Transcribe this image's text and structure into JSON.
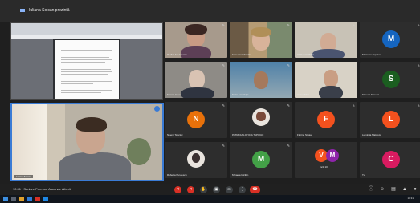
{
  "window": {
    "title": "Iuliana Soican prezintă"
  },
  "shared_screen": {
    "caption": ""
  },
  "presenter": {
    "name": "Iuliana Soican"
  },
  "participants": [
    {
      "name": "Rodica Medeleanu",
      "kind": "video"
    },
    {
      "name": "Florentina Zamfir",
      "kind": "video"
    },
    {
      "name": "Chirtoacă Mihai",
      "kind": "video"
    },
    {
      "name": "Marioara Tapciuc",
      "kind": "avatar",
      "initial": "M",
      "color": "#1565c0"
    },
    {
      "name": "Mircea Ciucu",
      "kind": "video"
    },
    {
      "name": "Sorin Amariuței",
      "kind": "video"
    },
    {
      "name": "Ancu Mihai",
      "kind": "video"
    },
    {
      "name": "Simona Simona",
      "kind": "avatar",
      "initial": "S",
      "color": "#1b5e20"
    },
    {
      "name": "Noemi Tapciuc",
      "kind": "avatar",
      "initial": "N",
      "color": "#e8710a"
    },
    {
      "name": "PATRICIA LOTICIA TAPCIUC",
      "kind": "photo"
    },
    {
      "name": "Florina Stroia",
      "kind": "avatar",
      "initial": "F",
      "color": "#f4511e"
    },
    {
      "name": "Luminita Malcovic",
      "kind": "avatar",
      "initial": "L",
      "color": "#f4511e"
    },
    {
      "name": "Roberta Puiulescu",
      "kind": "photo"
    },
    {
      "name": "Mihaela Istrătin",
      "kind": "avatar",
      "initial": "M",
      "color": "#43a047"
    },
    {
      "name": "Încă 10",
      "kind": "group",
      "initial": "V",
      "initial2": "M",
      "color": "#f4511e",
      "color2": "#8e24aa"
    },
    {
      "name": "Tu",
      "kind": "avatar",
      "initial": "C",
      "color": "#d81b60"
    }
  ],
  "controls": {
    "time": "10:31",
    "meeting_title": "Seniore Formare Alumnae Alberti",
    "separator": "|"
  },
  "taskbar": {
    "clock": "10:31"
  }
}
